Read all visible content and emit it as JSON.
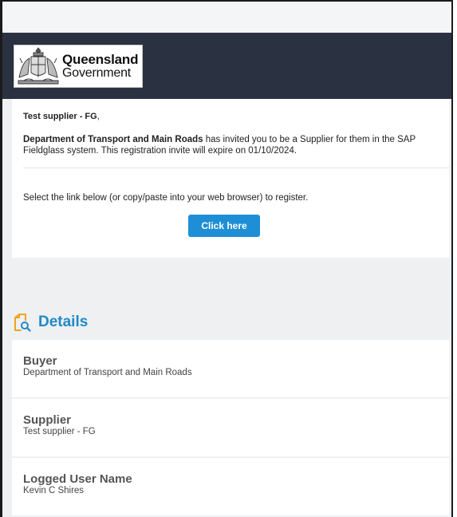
{
  "logo": {
    "line1": "Queensland",
    "line2": "Government"
  },
  "email": {
    "greeting_name": "Test supplier - FG",
    "greeting_punct": ",",
    "sender": "Department of Transport and Main Roads",
    "message": " has invited you to be a Supplier for them in the SAP Fieldglass system. This registration invite will expire on 01/10/2024.",
    "select_text": "Select the link below (or copy/paste into your web browser) to register.",
    "button_label": "Click here"
  },
  "details": {
    "title": "Details",
    "rows": [
      {
        "label": "Buyer",
        "value": "Department of Transport and Main Roads"
      },
      {
        "label": "Supplier",
        "value": "Test supplier - FG"
      },
      {
        "label": "Logged User Name",
        "value": "Kevin C Shires"
      }
    ]
  },
  "colors": {
    "header_bg": "#2a3242",
    "accent_blue": "#1e8fd6",
    "title_blue": "#2189c6",
    "icon_orange": "#f0a31c"
  },
  "icons": {
    "crest": "queensland-crest-icon",
    "details": "document-search-icon"
  }
}
